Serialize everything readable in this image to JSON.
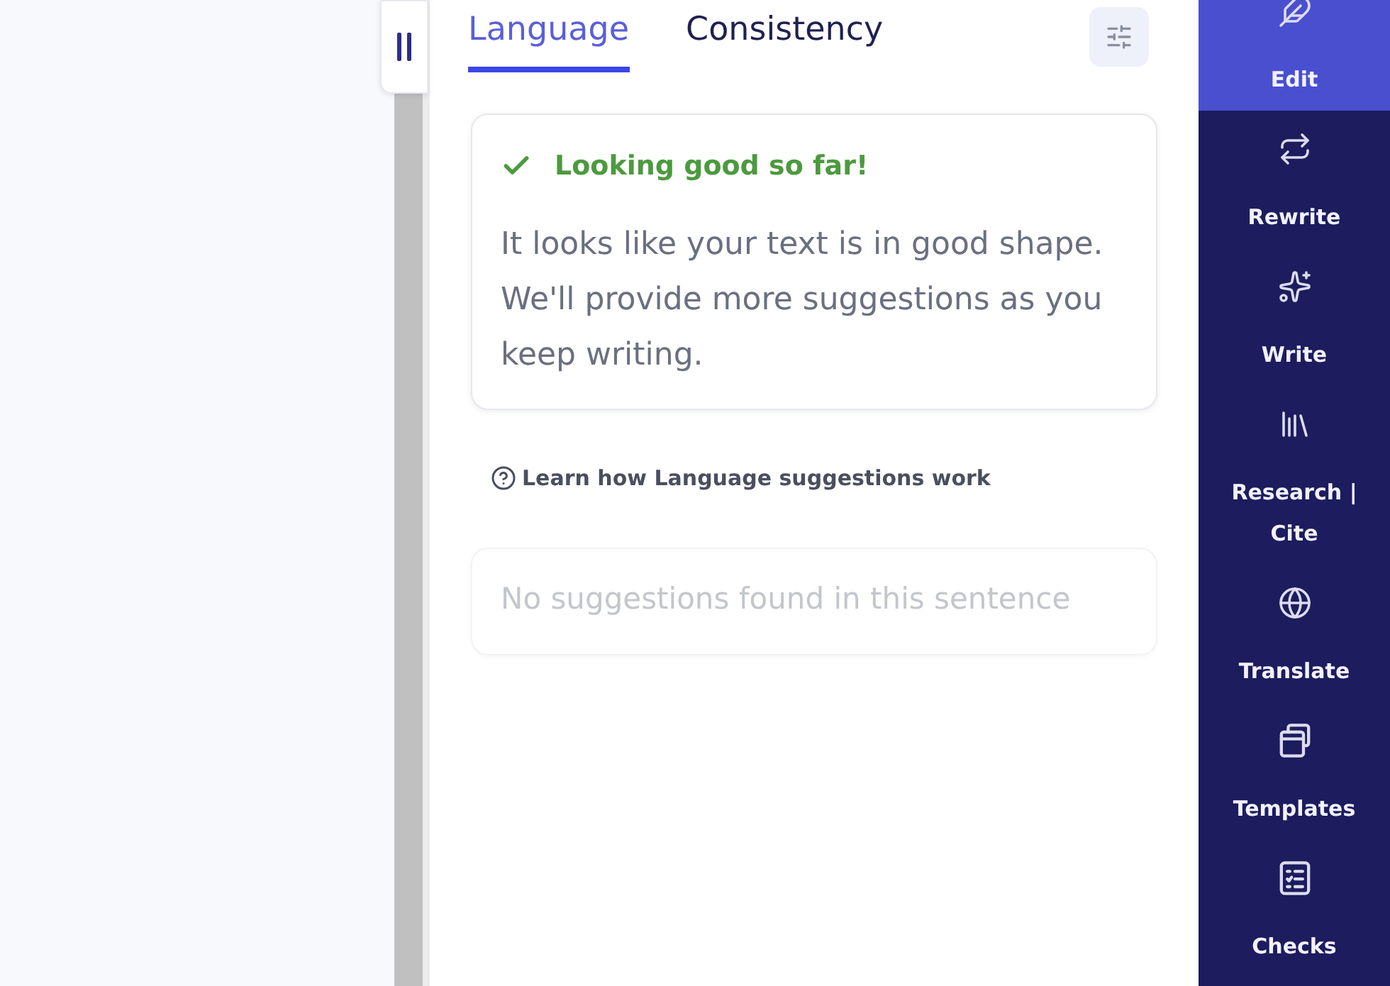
{
  "tabs": [
    {
      "label": "Language",
      "selected": true
    },
    {
      "label": "Consistency",
      "selected": false
    }
  ],
  "status_card": {
    "title": "Looking good so far!",
    "message": "It looks like your text is in good shape. We'll provide more suggestions as you keep writing."
  },
  "help_link": {
    "label": "Learn how Language suggestions work"
  },
  "empty_card": {
    "message": "No suggestions found in this sentence"
  },
  "sidebar": {
    "items": [
      {
        "label": "Edit",
        "selected": true
      },
      {
        "label": "Rewrite",
        "selected": false
      },
      {
        "label": "Write",
        "selected": false
      },
      {
        "label": "Research | Cite",
        "selected": false
      },
      {
        "label": "Translate",
        "selected": false
      },
      {
        "label": "Templates",
        "selected": false
      },
      {
        "label": "Checks",
        "selected": false
      }
    ]
  }
}
